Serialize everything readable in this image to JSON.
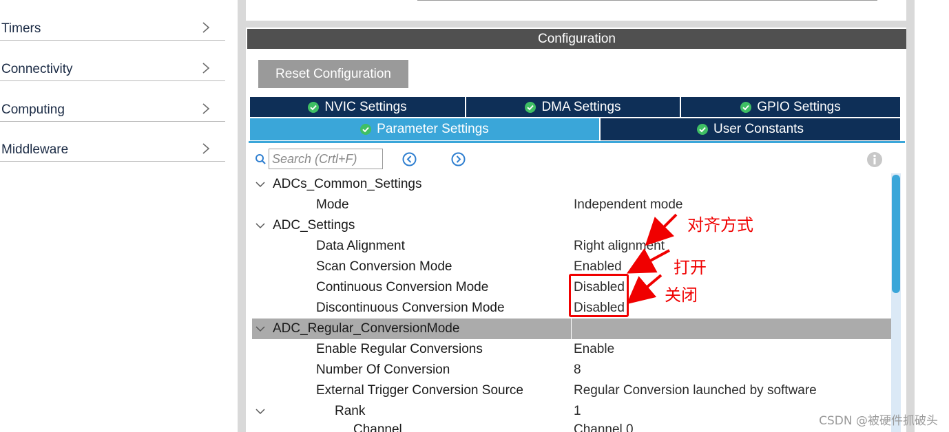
{
  "sidebar": {
    "categories": [
      {
        "label": "Timers"
      },
      {
        "label": "Connectivity"
      },
      {
        "label": "Computing"
      },
      {
        "label": "Middleware"
      }
    ]
  },
  "config": {
    "header": "Configuration",
    "reset_button": "Reset Configuration"
  },
  "tabs": [
    {
      "label": "NVIC Settings",
      "active": false
    },
    {
      "label": "DMA Settings",
      "active": false
    },
    {
      "label": "GPIO Settings",
      "active": false
    },
    {
      "label": "Parameter Settings",
      "active": true
    },
    {
      "label": "User Constants",
      "active": false
    }
  ],
  "search": {
    "placeholder": "Search (Crtl+F)"
  },
  "parameters": [
    {
      "name": "ADCs_Common_Settings",
      "value": "",
      "level": 0,
      "group": true
    },
    {
      "name": "Mode",
      "value": "Independent mode",
      "level": 1
    },
    {
      "name": "ADC_Settings",
      "value": "",
      "level": 0,
      "group": true
    },
    {
      "name": "Data Alignment",
      "value": "Right alignment",
      "level": 1
    },
    {
      "name": "Scan Conversion Mode",
      "value": "Enabled",
      "level": 1
    },
    {
      "name": "Continuous Conversion Mode",
      "value": "Disabled",
      "level": 1
    },
    {
      "name": "Discontinuous Conversion Mode",
      "value": "Disabled",
      "level": 1
    },
    {
      "name": "ADC_Regular_ConversionMode",
      "value": "",
      "level": 0,
      "group": true,
      "highlighted": true
    },
    {
      "name": "Enable Regular Conversions",
      "value": "Enable",
      "level": 1
    },
    {
      "name": "Number Of Conversion",
      "value": "8",
      "level": 1
    },
    {
      "name": "External Trigger Conversion Source",
      "value": "Regular Conversion launched by software",
      "level": 1
    },
    {
      "name": "Rank",
      "value": "1",
      "level": 2,
      "group": true
    },
    {
      "name": "Channel",
      "value": "Channel 0",
      "level": 3
    }
  ],
  "annotations": {
    "alignment": "对齐方式",
    "open": "打开",
    "close": "关闭"
  },
  "watermark": "CSDN @被硬件抓破头",
  "colors": {
    "tab_dark": "#0e2f57",
    "tab_active": "#3aa6d9",
    "header_bg": "#505050",
    "highlight_row": "#ababab",
    "annotation_red": "#f00000"
  }
}
